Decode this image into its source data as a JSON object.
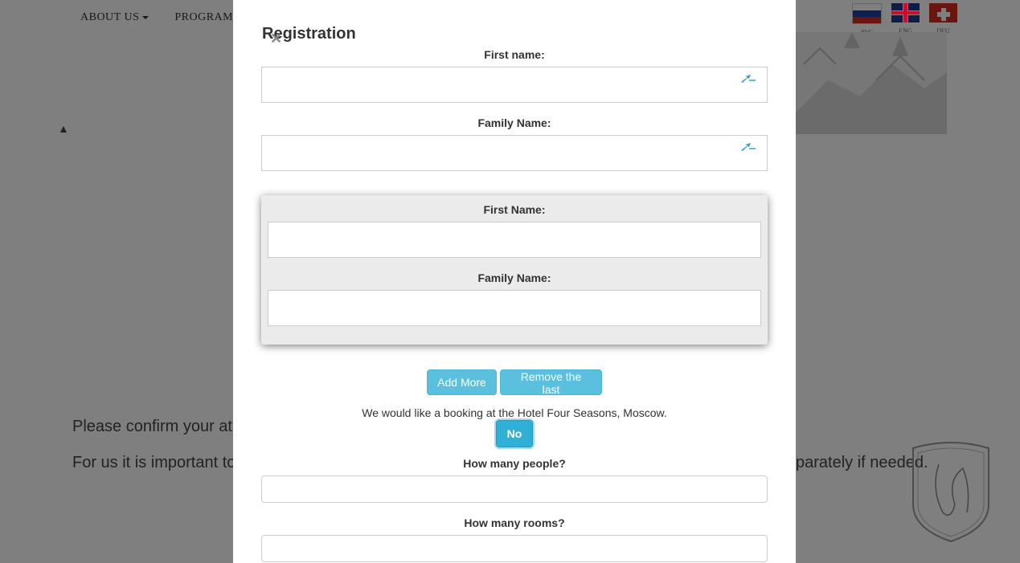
{
  "background": {
    "nav": {
      "about_label": "ABOUT US",
      "program_label": "PROGRAM"
    },
    "flags": [
      {
        "icon": "russia-flag-icon",
        "label": "РУС"
      },
      {
        "icon": "uk-flag-icon",
        "label": "ENG"
      },
      {
        "icon": "swiss-flag-icon",
        "label": "DEU"
      }
    ],
    "text_line1": "Please confirm your at",
    "text_line2": "For us it is important to",
    "text_right": "parately if needed."
  },
  "modal": {
    "title": "Registration",
    "close_icon": "close-icon",
    "first_name_label": "First name:",
    "family_name_label": "Family Name:",
    "guest": {
      "first_name_label": "First Name:",
      "family_name_label": "Family Name:"
    },
    "add_more_label": "Add More",
    "remove_last_label": "Remove the last",
    "booking_text": "We would like a booking at the Hotel Four Seasons, Moscow.",
    "booking_toggle_label": "No",
    "people_label": "How many people?",
    "rooms_label": "How many rooms?",
    "accent_color": "#5bc0de"
  }
}
